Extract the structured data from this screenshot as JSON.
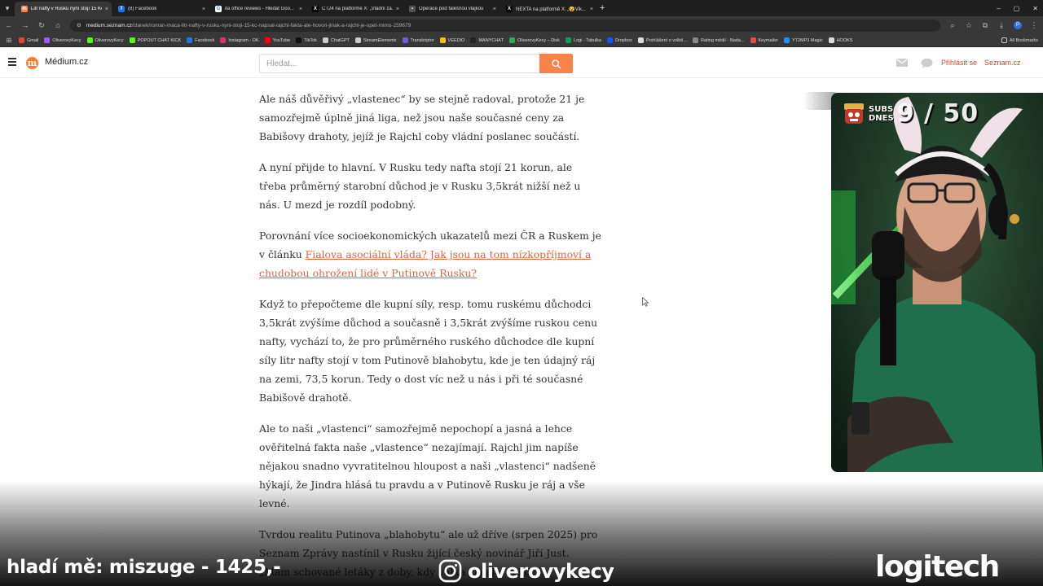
{
  "browser": {
    "tabs": [
      {
        "label": "Litr nafty v Rusku nyní stojí 15 Kč",
        "fav_color": "#f7834b",
        "fav_glyph": "m",
        "active": true
      },
      {
        "label": "(8) Facebook",
        "fav_color": "#1877f2",
        "fav_glyph": "f",
        "active": false
      },
      {
        "label": "ita office reviews - Hledat Goo...",
        "fav_color": "#ffffff",
        "fav_glyph": "G",
        "active": false
      },
      {
        "label": "ČT24 na platformě X: „Vládní zá...",
        "fav_color": "#000000",
        "fav_glyph": "X",
        "active": false
      },
      {
        "label": "Operace pod falešnou vlajkou",
        "fav_color": "#555555",
        "fav_glyph": "▪",
        "active": false
      },
      {
        "label": "NEXTA na platformě X: „😮Vik...",
        "fav_color": "#000000",
        "fav_glyph": "X",
        "active": false
      }
    ],
    "close_glyph": "×",
    "new_tab_glyph": "+",
    "window_controls": [
      "–",
      "▢",
      "✕"
    ],
    "url_host": "medium.seznam.cz",
    "url_path": "/clanek/roman-maca-litr-nafty-v-rusku-nyni-stoji-15-kc-napsal-rajchl-fakta-ale-hovori-jinak-a-rajchl-je-opet-mimo-259679",
    "profile_initial": "P",
    "bookmarks": [
      {
        "label": "Gmail",
        "color": "#ea4335"
      },
      {
        "label": "OliverovyKecy",
        "color": "#a259ff"
      },
      {
        "label": "OliverovyKecy",
        "color": "#53fc18"
      },
      {
        "label": "POPOUT CHAT KICK",
        "color": "#53fc18"
      },
      {
        "label": "Facebook",
        "color": "#1877f2"
      },
      {
        "label": "Instagram - OK",
        "color": "#e1306c"
      },
      {
        "label": "YouTube",
        "color": "#ff0000"
      },
      {
        "label": "TikTok",
        "color": "#111111"
      },
      {
        "label": "ChatGPT",
        "color": "#cccccc"
      },
      {
        "label": "StreamElements",
        "color": "#cccccc"
      },
      {
        "label": "Transkriptor",
        "color": "#6c5ce7"
      },
      {
        "label": "VEEDIO",
        "color": "#f1c40f"
      },
      {
        "label": "MANYCHAT",
        "color": "#222222"
      },
      {
        "label": "OliverovyKecy – Disk",
        "color": "#34a853"
      },
      {
        "label": "Logi - Tabulka",
        "color": "#0f9d58"
      },
      {
        "label": "Dropbox",
        "color": "#0061ff"
      },
      {
        "label": "Prohlášení o volbě...",
        "color": "#dddddd"
      },
      {
        "label": "Rating médií - Nada...",
        "color": "#888888"
      },
      {
        "label": "Keymailer",
        "color": "#e74c3c"
      },
      {
        "label": "YT2MP3 Magic",
        "color": "#1e90ff"
      },
      {
        "label": "HOOKS",
        "color": "#dddddd"
      }
    ],
    "all_bookmarks": "All Bookmarks"
  },
  "site": {
    "logo_letter": "m",
    "logo_text": "Médium.cz",
    "search_placeholder": "Hledat...",
    "login": "Přihlásit se",
    "seznam": "Seznam.cz",
    "accent": "#f7834b"
  },
  "article": {
    "p1": "Ale náš důvěřivý „vlastenec“ by se stejně radoval, protože 21 je samozřejmě úplně jiná liga, než jsou naše současné ceny za Babišovy drahoty, jejíž je Rajchl coby vládní poslanec součástí.",
    "p2": "A nyní přijde to hlavní. V Rusku tedy nafta stojí 21 korun, ale třeba průměrný starobní důchod je v Rusku 3,5krát nižší než u nás. U mezd je rozdíl podobný.",
    "p3_text": "Porovnání více socioekonomických ukazatelů mezi ČR a Ruskem je v článku ",
    "p3_link": "Fialova asociální vláda? Jak jsou na tom nízkopříjmoví a chudobou ohrožení lidé v Putinově Rusku?",
    "p4": "Když to přepočteme dle kupní síly, resp. tomu ruskému důchodci 3,5krát zvýšíme důchod a současně i 3,5krát zvýšíme ruskou cenu nafty, vychází to, že pro průměrného ruského důchodce dle kupní síly litr nafty stojí v tom Putinově blahobytu, kde je ten údajný ráj na zemi, 73,5 korun. Tedy o dost víc než u nás i při té současné Babišově drahotě.",
    "p5": "Ale to naši „vlastenci“ samozřejmě nepochopí a jasná a lehce ověřitelná fakta naše „vlastence“ nezajímají. Rajchl jim napíše nějakou snadno vyvratitelnou hloupost a naši „vlastenci“ nadšeně hýkají, že Jindra hlásá tu pravdu a v Putinově Rusku je ráj a vše levné.",
    "p6": "Tvrdou realitu Putinova „blahobytu“ ale už dříve (srpen 2025) pro Seznam Zprávy nastínil v Rusku žijící český novinář Jiří Just. „Mám schované letáky z doby, kdy válka začala. A když..."
  },
  "stream": {
    "subs_label_line1": "SUBS",
    "subs_label_line2": "DNES",
    "subs_count": "9 / 50",
    "ticker": "hladí mě: miszuge - 1425,-",
    "instagram_handle": "oliverovykecy",
    "sponsor": "logitech"
  }
}
